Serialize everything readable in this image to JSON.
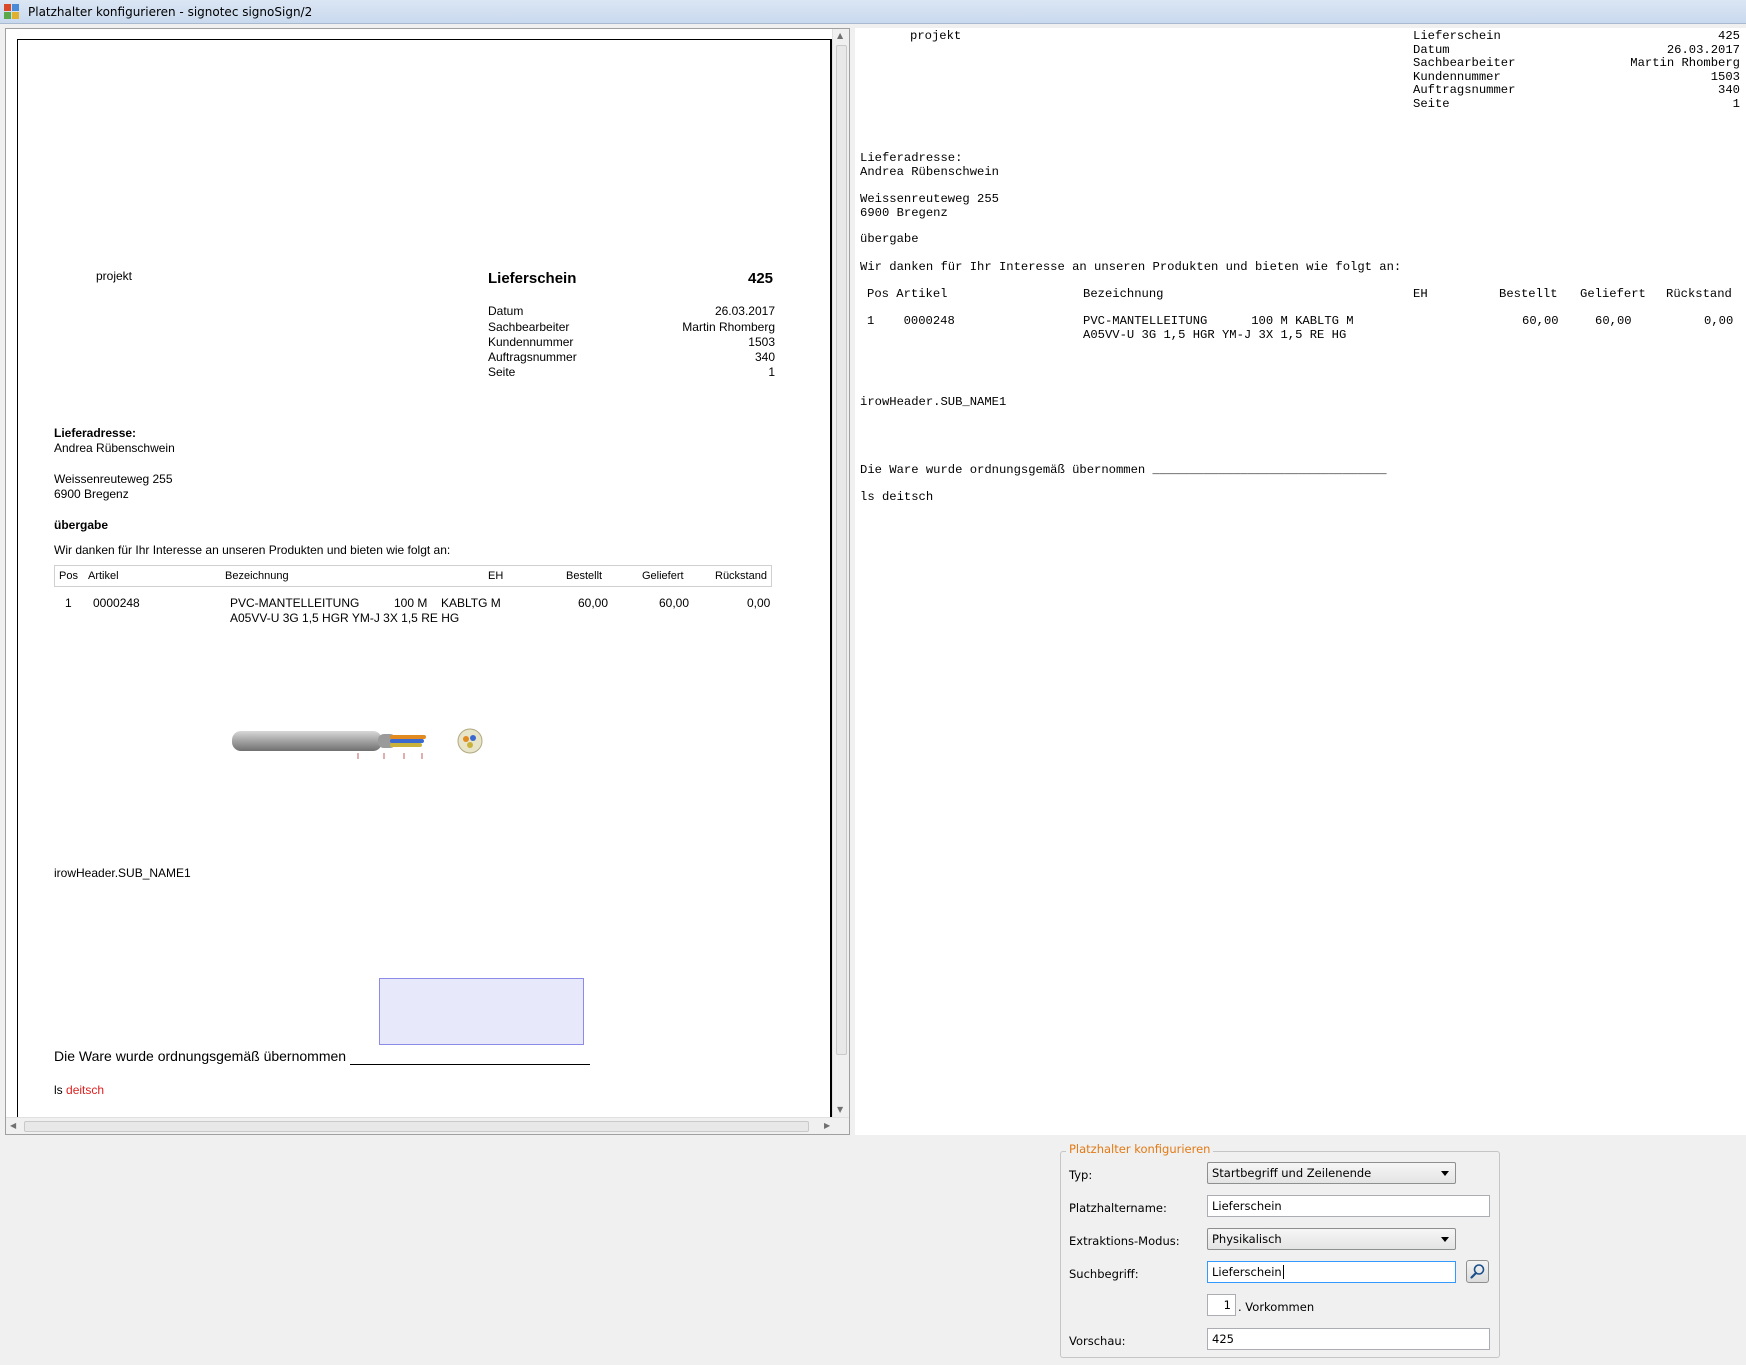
{
  "window": {
    "title": "Platzhalter konfigurieren - signotec signoSign/2"
  },
  "document": {
    "project": "projekt",
    "heading": "Lieferschein",
    "heading_number": "425",
    "meta": [
      {
        "label": "Datum",
        "value": "26.03.2017"
      },
      {
        "label": "Sachbearbeiter",
        "value": "Martin Rhomberg"
      },
      {
        "label": "Kundennummer",
        "value": "1503"
      },
      {
        "label": "Auftragsnummer",
        "value": "340"
      },
      {
        "label": "Seite",
        "value": "1"
      }
    ],
    "address_label": "Lieferadresse:",
    "address_name": "Andrea Rübenschwein",
    "address_street": "Weissenreuteweg 255",
    "address_city": "6900 Bregenz",
    "section": "übergabe",
    "intro": "Wir danken für Ihr Interesse an unseren Produkten und bieten wie folgt an:",
    "table_headers": {
      "pos": "Pos",
      "artikel": "Artikel",
      "bezeichnung": "Bezeichnung",
      "eh": "EH",
      "bestellt": "Bestellt",
      "geliefert": "Geliefert",
      "rueckstand": "Rückstand"
    },
    "table_row": {
      "pos": "1",
      "artikel": "0000248",
      "bez1": "PVC-MANTELLEITUNG",
      "qty": "100 M",
      "unit": "KABLTG M",
      "bez2": "A05VV-U  3G 1,5  HGR YM-J  3X 1,5 RE  HG",
      "bestellt": "60,00",
      "geliefert": "60,00",
      "rueckstand": "0,00"
    },
    "sub_name": "irowHeader.SUB_NAME1",
    "confirm": "Die Ware wurde ordnungsgemäß übernommen",
    "footer_prefix": "ls",
    "footer_red": "deitsch"
  },
  "text_preview": {
    "header_label": "projekt",
    "meta": [
      {
        "label": "Lieferschein",
        "value": "425"
      },
      {
        "label": "Datum",
        "value": "26.03.2017"
      },
      {
        "label": "Sachbearbeiter",
        "value": "Martin Rhomberg"
      },
      {
        "label": "Kundennummer",
        "value": "1503"
      },
      {
        "label": "Auftragsnummer",
        "value": "340"
      },
      {
        "label": "Seite",
        "value": "1"
      }
    ],
    "address_label": "Lieferadresse:",
    "address_name": "Andrea Rübenschwein",
    "address_street": "Weissenreuteweg 255",
    "address_city": "6900 Bregenz",
    "section": "übergabe",
    "intro": "Wir danken für Ihr Interesse an unseren Produkten und bieten wie folgt an:",
    "table_header": "Pos Artikel",
    "col_bez": "Bezeichnung",
    "col_eh": "EH",
    "col_bestellt": "Bestellt",
    "col_geliefert": "Geliefert",
    "col_rueckstand": "Rückstand",
    "row_pos": "1    0000248",
    "row_bez1": "PVC-MANTELLEITUNG      100 M KABLTG M",
    "row_bez2": "A05VV-U 3G 1,5 HGR YM-J 3X 1,5 RE HG",
    "row_bestellt": "60,00",
    "row_geliefert": "60,00",
    "row_rueckstand": "0,00",
    "sub_name": "irowHeader.SUB_NAME1",
    "confirm": "Die Ware wurde ordnungsgemäß übernommen ________________________________",
    "footer": "ls deitsch"
  },
  "config": {
    "group_title": "Platzhalter konfigurieren",
    "typ_label": "Typ:",
    "typ_value": "Startbegriff und Zeilenende",
    "name_label": "Platzhaltername:",
    "name_value": "Lieferschein",
    "mode_label": "Extraktions-Modus:",
    "mode_value": "Physikalisch",
    "search_label": "Suchbegriff:",
    "search_value": "Lieferschein",
    "occurrence_value": "1",
    "occurrence_label": ". Vorkommen",
    "preview_label": "Vorschau:",
    "preview_value": "425"
  },
  "colors": {
    "accent_orange": "#e27a16",
    "footer_red": "#e02020",
    "signature_fill": "#e8e8fb",
    "signature_border": "#8c8ce8"
  },
  "icons": {
    "app": "signotec-app-icon",
    "search": "magnifier-icon"
  }
}
